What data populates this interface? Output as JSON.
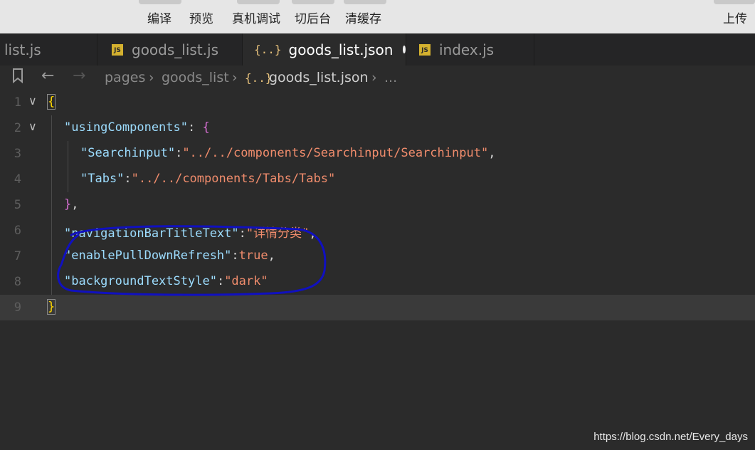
{
  "toolbar": {
    "compile": "编译",
    "preview": "预览",
    "remote_debug": "真机调试",
    "background": "切后台",
    "clear_cache": "清缓存",
    "upload": "上传"
  },
  "tabs": [
    {
      "label": "list.js",
      "icon": "none",
      "active": false
    },
    {
      "label": "goods_list.js",
      "icon": "js-file-icon",
      "active": false
    },
    {
      "label": "goods_list.json",
      "icon": "json-file-icon",
      "active": true,
      "modified": true
    },
    {
      "label": "index.js",
      "icon": "js-file-icon",
      "active": false
    }
  ],
  "icons": {
    "js_badge": "JS",
    "json_badge": "{..}"
  },
  "breadcrumb": {
    "p1": "pages",
    "p2": "goods_list",
    "json_icon": "{..}",
    "p3": "goods_list.json",
    "p4": "..."
  },
  "editor": {
    "line_numbers": [
      "1",
      "2",
      "3",
      "4",
      "5",
      "6",
      "7",
      "8",
      "9"
    ],
    "current_line": 9,
    "lines": {
      "l1": {
        "brace": "{"
      },
      "l2": {
        "key": "\"usingComponents\"",
        "colon": ": ",
        "brace": "{"
      },
      "l3": {
        "key": "\"Searchinput\"",
        "colon": ":",
        "value": "\"../../components/Searchinput/Searchinput\"",
        "comma": ","
      },
      "l4": {
        "key": "\"Tabs\"",
        "colon": ":",
        "value": "\"../../components/Tabs/Tabs\""
      },
      "l5": {
        "brace": "}",
        "comma": ","
      },
      "l6": {
        "key": "\"navigationBarTitleText\"",
        "colon": ":",
        "value": "\"详情分类\"",
        "comma": ","
      },
      "l7": {
        "key": "\"enablePullDownRefresh\"",
        "colon": ":",
        "value": "true",
        "comma": ","
      },
      "l8": {
        "key": "\"backgroundTextStyle\"",
        "colon": ":",
        "value": "\"dark\""
      },
      "l9": {
        "brace": "}"
      }
    }
  },
  "watermark": "https://blog.csdn.net/Every_days",
  "colors": {
    "annotation": "#1010c0",
    "string": "#f08c6c",
    "key": "#9cdcfe",
    "bracket": "#ffd700",
    "inner_brace": "#da70d6"
  }
}
